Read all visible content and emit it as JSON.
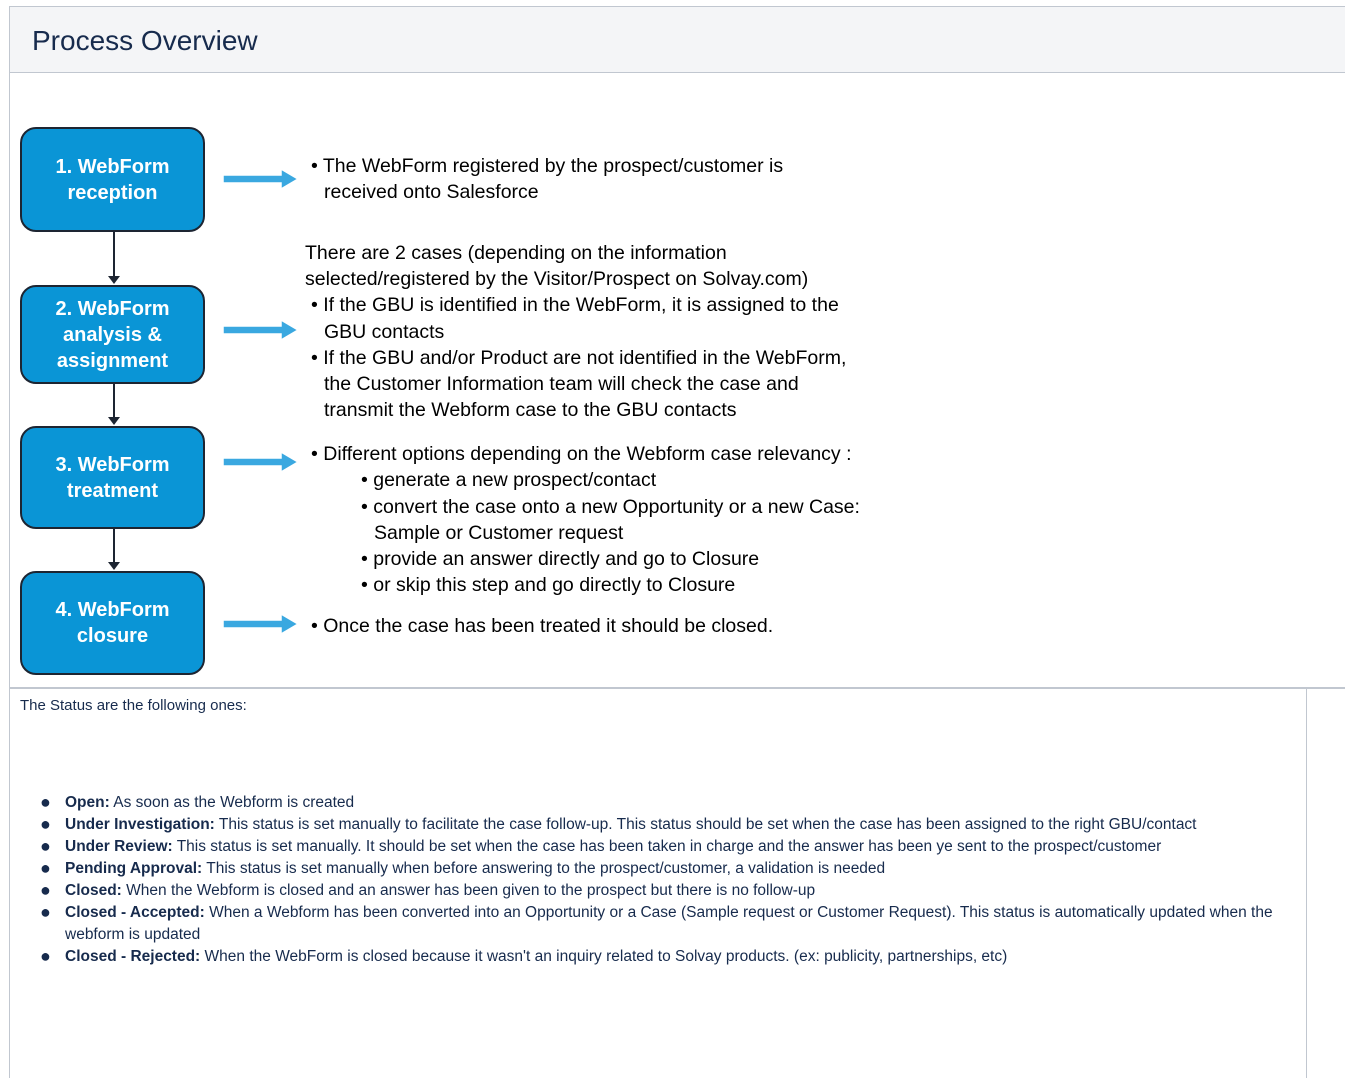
{
  "title": "Process Overview",
  "steps": [
    {
      "label": "1. WebForm\nreception"
    },
    {
      "label": "2. WebForm\nanalysis &\nassignment"
    },
    {
      "label": "3. WebForm\ntreatment"
    },
    {
      "label": "4. WebForm\nclosure"
    }
  ],
  "descriptions": {
    "d1_l1": "• The WebForm registered by the prospect/customer is",
    "d1_l2": "received onto Salesforce",
    "d2_l1": "There are 2 cases (depending on the information",
    "d2_l2": "selected/registered by the Visitor/Prospect on Solvay.com)",
    "d2_l3": "• If the GBU is identified in the WebForm, it is assigned to the",
    "d2_l4": "GBU contacts",
    "d2_l5": "• If the GBU and/or Product are not identified in the WebForm,",
    "d2_l6": "the Customer Information team will check the case and",
    "d2_l7": "transmit the Webform case to the GBU contacts",
    "d3_l1": "• Different options depending on the Webform case relevancy :",
    "d3_l2": "• generate a new prospect/contact",
    "d3_l3": "• convert the case onto a new Opportunity or a new Case:",
    "d3_l4": "Sample or Customer request",
    "d3_l5": "• provide an answer directly and go to Closure",
    "d3_l6": "• or skip this step and go directly to Closure",
    "d4_l1": "• Once the case has been treated it should be closed."
  },
  "status_intro": "The Status are the following ones:",
  "statuses": [
    {
      "name": "Open:",
      "desc": " As soon as the Webform is created"
    },
    {
      "name": "Under Investigation:",
      "desc": " This status is set manually to facilitate the case follow-up. This status should be set when the case has been assigned to the right GBU/contact"
    },
    {
      "name": "Under Review:",
      "desc": " This status is set manually. It should be set when the case has been taken in charge and the answer has been ye sent to the prospect/customer"
    },
    {
      "name": "Pending Approval:",
      "desc": " This status is set manually when before answering to the prospect/customer, a validation is needed"
    },
    {
      "name": "Closed:",
      "desc": " When the Webform is closed and an answer has been given to the prospect but there is no follow-up"
    },
    {
      "name": "Closed - Accepted:",
      "desc": " When a Webform has been converted into an Opportunity or a Case (Sample request or Customer Request). This status is automatically updated when the webform is updated"
    },
    {
      "name": "Closed - Rejected:",
      "desc": " When the WebForm is closed because it wasn't an inquiry related to Solvay products. (ex: publicity, partnerships, etc)"
    }
  ],
  "colors": {
    "box_fill": "#0a95d6",
    "arrow": "#3aa8e0"
  }
}
